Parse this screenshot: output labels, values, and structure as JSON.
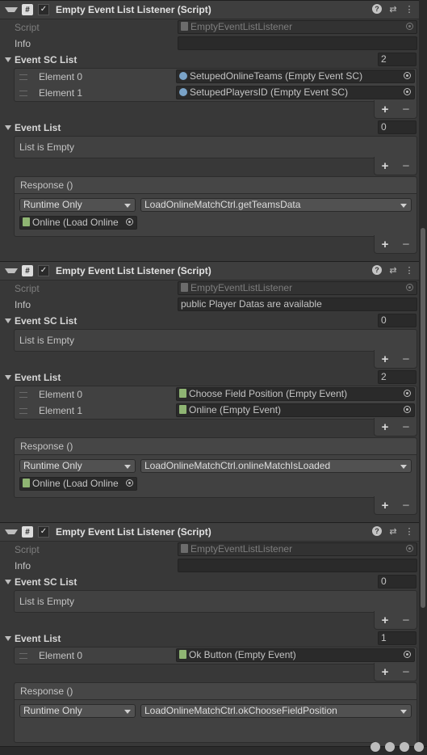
{
  "components": [
    {
      "title": "Empty Event List Listener (Script)",
      "script_label": "Script",
      "script_value": "EmptyEventListListener",
      "info_label": "Info",
      "info_value": "",
      "sc_list_label": "Event SC List",
      "sc_list_count": "2",
      "sc_elements": [
        {
          "label": "Element 0",
          "value": "SetupedOnlineTeams (Empty Event SC)"
        },
        {
          "label": "Element 1",
          "value": "SetupedPlayersID (Empty Event SC)"
        }
      ],
      "sc_list_empty": "",
      "event_list_label": "Event List",
      "event_list_count": "0",
      "event_elements": [],
      "event_list_empty": "List is Empty",
      "response_label": "Response ()",
      "runtime_label": "Runtime Only",
      "method": "LoadOnlineMatchCtrl.getTeamsData",
      "target": "Online (Load Online"
    },
    {
      "title": "Empty Event List Listener (Script)",
      "script_label": "Script",
      "script_value": "EmptyEventListListener",
      "info_label": "Info",
      "info_value": "public Player Datas are available",
      "sc_list_label": "Event SC List",
      "sc_list_count": "0",
      "sc_elements": [],
      "sc_list_empty": "List is Empty",
      "event_list_label": "Event List",
      "event_list_count": "2",
      "event_elements": [
        {
          "label": "Element 0",
          "value": "Choose Field Position (Empty Event)"
        },
        {
          "label": "Element 1",
          "value": "Online (Empty Event)"
        }
      ],
      "event_list_empty": "",
      "response_label": "Response ()",
      "runtime_label": "Runtime Only",
      "method": "LoadOnlineMatchCtrl.onlineMatchIsLoaded",
      "target": "Online (Load Online"
    },
    {
      "title": "Empty Event List Listener (Script)",
      "script_label": "Script",
      "script_value": "EmptyEventListListener",
      "info_label": "Info",
      "info_value": "",
      "sc_list_label": "Event SC List",
      "sc_list_count": "0",
      "sc_elements": [],
      "sc_list_empty": "List is Empty",
      "event_list_label": "Event List",
      "event_list_count": "1",
      "event_elements": [
        {
          "label": "Element 0",
          "value": "Ok Button (Empty Event)"
        }
      ],
      "event_list_empty": "",
      "response_label": "Response ()",
      "runtime_label": "Runtime Only",
      "method": "LoadOnlineMatchCtrl.okChooseFieldPosition",
      "target": ""
    }
  ],
  "icons": {
    "script": "#",
    "check": "✓",
    "help": "?",
    "presets": "⇄",
    "menu": "⋮",
    "plus": "+",
    "minus": "−"
  }
}
